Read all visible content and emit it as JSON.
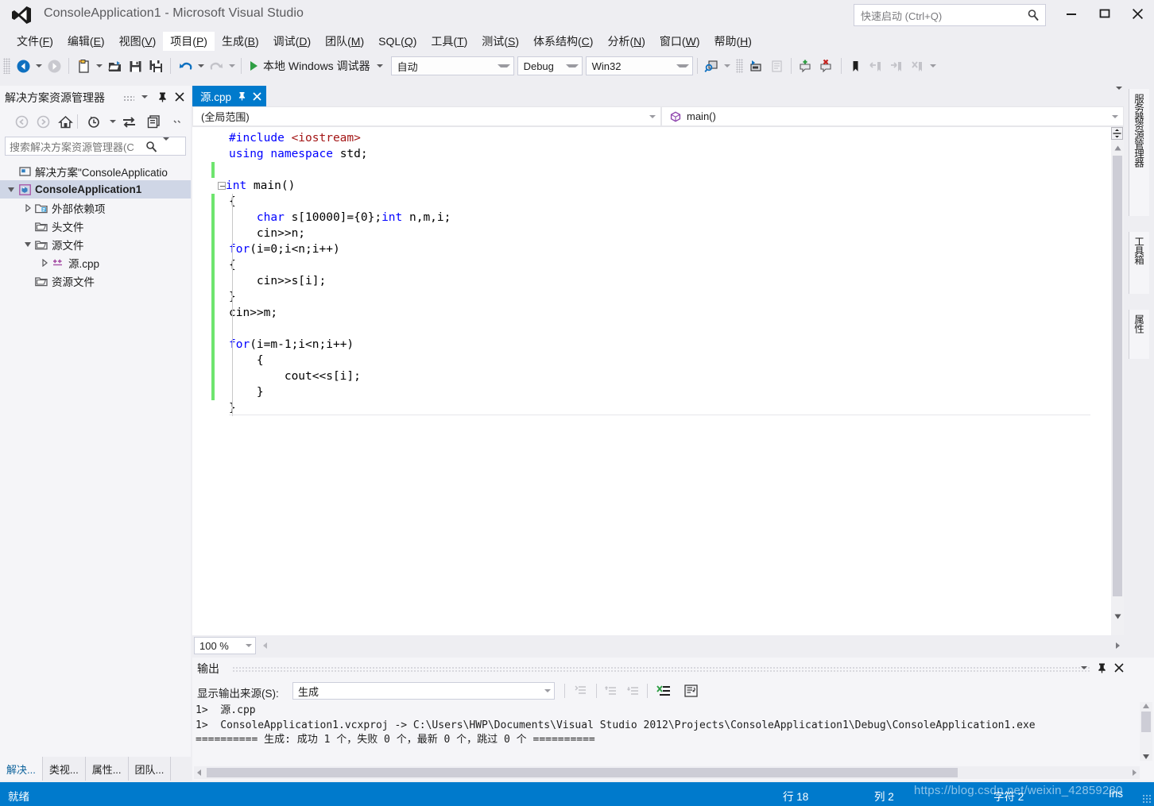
{
  "window": {
    "title": "ConsoleApplication1 - Microsoft Visual Studio",
    "logo_icon": "visual-studio-logo",
    "minimize_icon": "minimize-icon",
    "maximize_icon": "maximize-icon",
    "close_icon": "close-icon"
  },
  "quick_launch": {
    "placeholder": "快速启动 (Ctrl+Q)",
    "icon": "search-icon"
  },
  "menubar": {
    "items": [
      {
        "label": "文件(F)",
        "active": false
      },
      {
        "label": "编辑(E)",
        "active": false
      },
      {
        "label": "视图(V)",
        "active": false
      },
      {
        "label": "项目(P)",
        "active": true
      },
      {
        "label": "生成(B)",
        "active": false
      },
      {
        "label": "调试(D)",
        "active": false
      },
      {
        "label": "团队(M)",
        "active": false
      },
      {
        "label": "SQL(Q)",
        "active": false
      },
      {
        "label": "工具(T)",
        "active": false
      },
      {
        "label": "测试(S)",
        "active": false
      },
      {
        "label": "体系结构(C)",
        "active": false
      },
      {
        "label": "分析(N)",
        "active": false
      },
      {
        "label": "窗口(W)",
        "active": false
      },
      {
        "label": "帮助(H)",
        "active": false
      }
    ]
  },
  "toolbar": {
    "back_icon": "navigate-back-icon",
    "forward_icon": "navigate-forward-icon",
    "new_project_icon": "new-project-icon",
    "open_file_icon": "open-file-icon",
    "save_icon": "save-icon",
    "save_all_icon": "save-all-icon",
    "undo_icon": "undo-icon",
    "redo_icon": "redo-icon",
    "run_label": "本地 Windows 调试器",
    "run_icon": "play-icon",
    "platform_target": "自动",
    "configuration": "Debug",
    "platform": "Win32",
    "find_icon": "find-in-files-icon",
    "navigate_to_icon": "navigate-to-icon",
    "comment_icon": "comment-selection-icon",
    "add_bookmark_icon": "add-comment-icon",
    "remove_bookmark_icon": "remove-comment-icon",
    "toggle_bookmark_icon": "bookmark-icon",
    "prev_bookmark_icon": "previous-bookmark-icon",
    "next_bookmark_icon": "next-bookmark-icon",
    "clear_bookmarks_icon": "clear-bookmarks-icon",
    "overflow_icon": "toolbar-overflow-icon"
  },
  "solution_explorer": {
    "title": "解决方案资源管理器",
    "dropdown_icon": "chevron-down-icon",
    "pin_icon": "pin-icon",
    "close_icon": "close-icon",
    "toolbar": {
      "back_icon": "back-icon",
      "forward_icon": "forward-icon",
      "home_icon": "home-icon",
      "pending_changes_icon": "pending-changes-icon",
      "sync_icon": "sync-with-active-document-icon",
      "refresh_icon": "refresh-icon",
      "show_all_files_icon": "show-all-files-icon",
      "properties_icon": "properties-icon",
      "overflow_icon": "overflow-icon"
    },
    "search_placeholder": "搜索解决方案资源管理器(C",
    "search_icon": "search-icon",
    "search_caret_icon": "chevron-down-icon",
    "tree": [
      {
        "label": "解决方案\"ConsoleApplicatio",
        "icon": "solution-icon",
        "indent": 1,
        "expander": "none",
        "selected": false,
        "bold": false
      },
      {
        "label": "ConsoleApplication1",
        "icon": "cpp-project-icon",
        "indent": 1,
        "expander": "open",
        "selected": true,
        "bold": true
      },
      {
        "label": "外部依赖项",
        "icon": "external-dependencies-icon",
        "indent": 2,
        "expander": "closed",
        "selected": false,
        "bold": false
      },
      {
        "label": "头文件",
        "icon": "folder-filter-icon",
        "indent": 2,
        "expander": "none",
        "selected": false,
        "bold": false
      },
      {
        "label": "源文件",
        "icon": "folder-filter-icon",
        "indent": 2,
        "expander": "open",
        "selected": false,
        "bold": false
      },
      {
        "label": "源.cpp",
        "icon": "cpp-file-icon",
        "indent": 3,
        "expander": "closed",
        "selected": false,
        "bold": false
      },
      {
        "label": "资源文件",
        "icon": "folder-filter-icon",
        "indent": 2,
        "expander": "none",
        "selected": false,
        "bold": false
      }
    ],
    "bottom_tabs": [
      {
        "label": "解决...",
        "active": true
      },
      {
        "label": "类视...",
        "active": false
      },
      {
        "label": "属性...",
        "active": false
      },
      {
        "label": "团队...",
        "active": false
      }
    ]
  },
  "editor": {
    "tab": {
      "title": "源.cpp",
      "pin_icon": "pin-icon",
      "close_icon": "close-icon"
    },
    "tabstrip_overflow_icon": "chevron-down-icon",
    "scope_combo": "(全局范围)",
    "member_combo": "main()",
    "member_icon": "method-icon",
    "scope_caret_icon": "chevron-down-icon",
    "member_caret_icon": "chevron-down-icon",
    "zoom_level": "100 %",
    "zoom_caret_icon": "chevron-down-icon",
    "splitter_icon": "split-view-icon",
    "scroll_up_icon": "scroll-up-arrow",
    "scroll_down_icon": "scroll-down-arrow",
    "scroll_left_icon": "scroll-left-arrow",
    "scroll_right_icon": "scroll-right-arrow",
    "code_lines": [
      {
        "indent": 1,
        "changed": false,
        "fold": false,
        "guide": false,
        "tokens": [
          {
            "t": "#include",
            "c": "pp"
          },
          {
            "t": " ",
            "c": "pl"
          },
          {
            "t": "<iostream>",
            "c": "str"
          }
        ]
      },
      {
        "indent": 1,
        "changed": false,
        "fold": false,
        "guide": false,
        "tokens": [
          {
            "t": "using",
            "c": "kw"
          },
          {
            "t": " ",
            "c": "pl"
          },
          {
            "t": "namespace",
            "c": "kw"
          },
          {
            "t": " std;",
            "c": "pl"
          }
        ]
      },
      {
        "indent": 0,
        "changed": true,
        "fold": false,
        "guide": false,
        "tokens": []
      },
      {
        "indent": 0,
        "changed": false,
        "fold": true,
        "guide": false,
        "tokens": [
          {
            "t": "int",
            "c": "kw"
          },
          {
            "t": " main()",
            "c": "pl"
          }
        ]
      },
      {
        "indent": 1,
        "changed": true,
        "fold": false,
        "guide": true,
        "tokens": [
          {
            "t": "{",
            "c": "pl"
          }
        ]
      },
      {
        "indent": 1,
        "changed": true,
        "fold": false,
        "guide": true,
        "tokens": [
          {
            "t": "    ",
            "c": "pl"
          },
          {
            "t": "char",
            "c": "kw"
          },
          {
            "t": " s[10000]={0};",
            "c": "pl"
          },
          {
            "t": "int",
            "c": "kw"
          },
          {
            "t": " n,m,i;",
            "c": "pl"
          }
        ]
      },
      {
        "indent": 1,
        "changed": true,
        "fold": false,
        "guide": true,
        "tokens": [
          {
            "t": "    cin>>n;",
            "c": "pl"
          }
        ]
      },
      {
        "indent": 1,
        "changed": true,
        "fold": false,
        "guide": true,
        "tokens": [
          {
            "t": "for",
            "c": "kw"
          },
          {
            "t": "(i=0;i<n;i++)",
            "c": "pl"
          }
        ]
      },
      {
        "indent": 1,
        "changed": true,
        "fold": false,
        "guide": true,
        "tokens": [
          {
            "t": "{",
            "c": "pl"
          }
        ]
      },
      {
        "indent": 1,
        "changed": true,
        "fold": false,
        "guide": true,
        "tokens": [
          {
            "t": "    cin>>s[i];",
            "c": "pl"
          }
        ]
      },
      {
        "indent": 1,
        "changed": true,
        "fold": false,
        "guide": true,
        "tokens": [
          {
            "t": "}",
            "c": "pl"
          }
        ]
      },
      {
        "indent": 1,
        "changed": true,
        "fold": false,
        "guide": true,
        "tokens": [
          {
            "t": "cin>>m;",
            "c": "pl"
          }
        ]
      },
      {
        "indent": 1,
        "changed": true,
        "fold": false,
        "guide": true,
        "tokens": []
      },
      {
        "indent": 1,
        "changed": true,
        "fold": false,
        "guide": true,
        "tokens": [
          {
            "t": "for",
            "c": "kw"
          },
          {
            "t": "(i=m-1;i<n;i++)",
            "c": "pl"
          }
        ]
      },
      {
        "indent": 1,
        "changed": true,
        "fold": false,
        "guide": true,
        "tokens": [
          {
            "t": "    {",
            "c": "pl"
          }
        ]
      },
      {
        "indent": 1,
        "changed": true,
        "fold": false,
        "guide": true,
        "tokens": [
          {
            "t": "        cout<<s[i];",
            "c": "pl"
          }
        ]
      },
      {
        "indent": 1,
        "changed": true,
        "fold": false,
        "guide": true,
        "tokens": [
          {
            "t": "    }",
            "c": "pl"
          }
        ]
      },
      {
        "indent": 1,
        "changed": false,
        "fold": false,
        "guide": true,
        "current": true,
        "tokens": [
          {
            "t": "}",
            "c": "pl"
          }
        ]
      }
    ]
  },
  "right_tabs": [
    {
      "label": "服务器资源管理器"
    },
    {
      "label": "工具箱"
    },
    {
      "label": "属性"
    }
  ],
  "output": {
    "title": "输出",
    "dropdown_icon": "chevron-down-icon",
    "pin_icon": "pin-icon",
    "close_icon": "close-icon",
    "source_label": "显示输出来源(S):",
    "source_value": "生成",
    "source_caret_icon": "chevron-down-icon",
    "find_msg_icon": "find-message-icon",
    "prev_msg_icon": "previous-message-icon",
    "next_msg_icon": "next-message-icon",
    "clear_icon": "clear-pane-icon",
    "wordwrap_icon": "toggle-word-wrap-icon",
    "lines": [
      "1>  源.cpp",
      "1>  ConsoleApplication1.vcxproj -> C:\\Users\\HWP\\Documents\\Visual Studio 2012\\Projects\\ConsoleApplication1\\Debug\\ConsoleApplication1.exe",
      "========== 生成: 成功 1 个，失败 0 个，最新 0 个，跳过 0 个 =========="
    ]
  },
  "statusbar": {
    "ready": "就绪",
    "line_label": "行 18",
    "col_label": "列 2",
    "char_label": "字符 2",
    "insert_mode": "Ins",
    "watermark": "https://blog.csdn.net/weixin_42859280"
  },
  "colors": {
    "accent": "#007acc",
    "chrome": "#eeeef2",
    "panel": "#f5f5f8",
    "keyword": "#0000ff",
    "string": "#a31515",
    "change_marker": "#6ee46e",
    "selection": "#cfd6e6"
  }
}
